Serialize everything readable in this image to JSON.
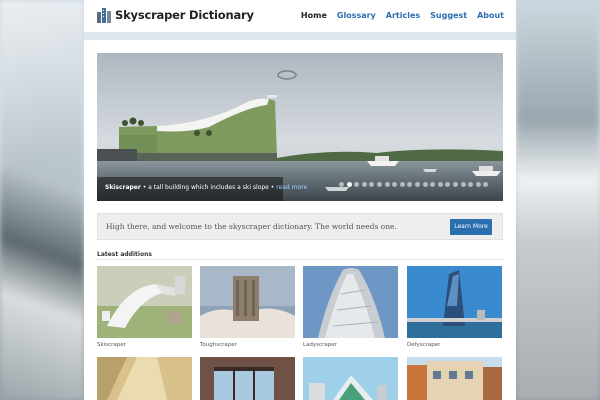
{
  "site": {
    "title": "Skyscraper Dictionary"
  },
  "nav": [
    "Home",
    "Glossary",
    "Articles",
    "Suggest",
    "About"
  ],
  "hero": {
    "term": "Skiscraper",
    "description": " • a tall building which includes a ski slope • ",
    "more": "read more",
    "slide_count": 20,
    "active_slide": 1
  },
  "welcome": {
    "text": "High there, and welcome to the skyscraper dictionary. The world needs one.",
    "button": "Learn More"
  },
  "latest": {
    "title": "Latest additions",
    "items": [
      "Skiscraper",
      "Toughscraper",
      "Ladyscraper",
      "Defyscraper",
      "",
      "",
      "",
      ""
    ]
  },
  "colors": {
    "link": "#2a6fb0",
    "button": "#2a6fb0"
  }
}
